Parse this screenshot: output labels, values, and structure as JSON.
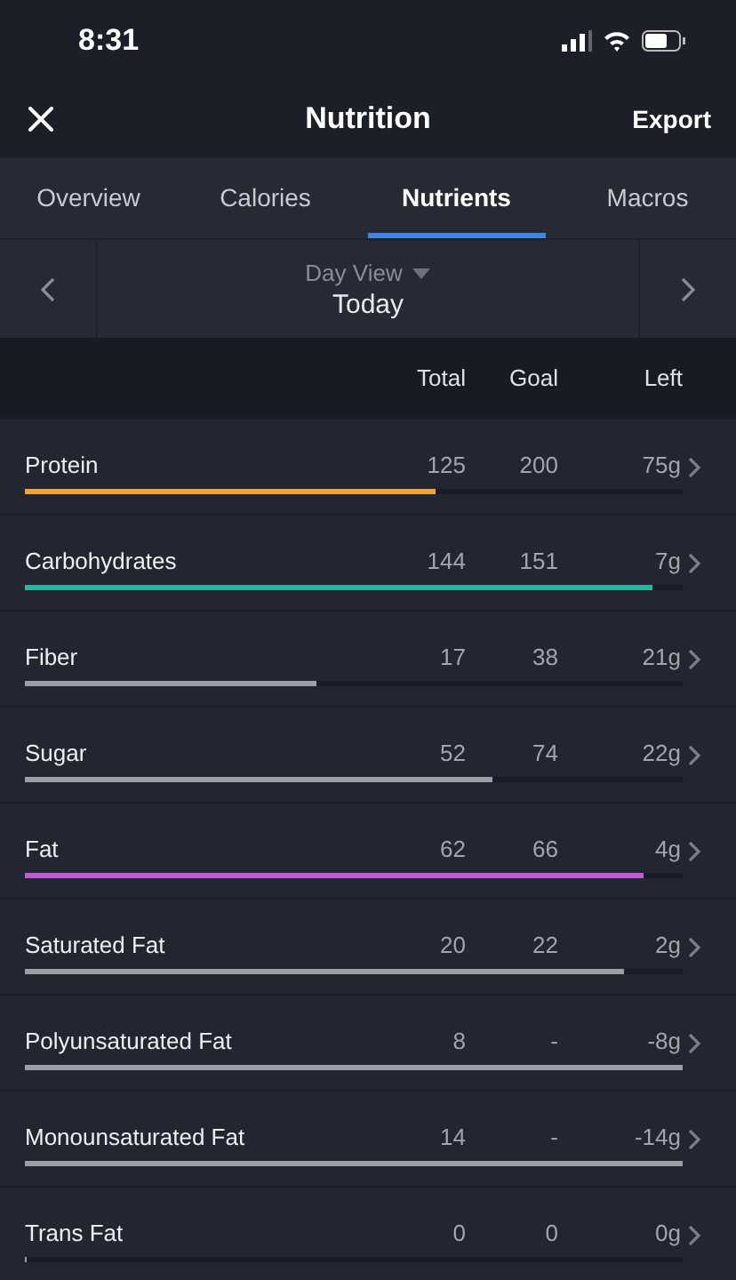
{
  "status_bar": {
    "time": "8:31"
  },
  "header": {
    "title": "Nutrition",
    "action": "Export"
  },
  "tabs": [
    {
      "label": "Overview",
      "selected": false
    },
    {
      "label": "Calories",
      "selected": false
    },
    {
      "label": "Nutrients",
      "selected": true
    },
    {
      "label": "Macros",
      "selected": false
    }
  ],
  "date_nav": {
    "view": "Day View",
    "date": "Today"
  },
  "columns": [
    "Total",
    "Goal",
    "Left"
  ],
  "nutrients": [
    {
      "name": "Protein",
      "total": "125",
      "goal": "200",
      "left": "75g",
      "level": 0.625,
      "color": "#f0a43a"
    },
    {
      "name": "Carbohydrates",
      "total": "144",
      "goal": "151",
      "left": "7g",
      "level": 0.953,
      "color": "#2bb5a0"
    },
    {
      "name": "Fiber",
      "total": "17",
      "goal": "38",
      "left": "21g",
      "level": 0.443,
      "color": "#9c9ea6"
    },
    {
      "name": "Sugar",
      "total": "52",
      "goal": "74",
      "left": "22g",
      "level": 0.71,
      "color": "#9c9ea6"
    },
    {
      "name": "Fat",
      "total": "62",
      "goal": "66",
      "left": "4g",
      "level": 0.94,
      "color": "#c05bd6"
    },
    {
      "name": "Saturated Fat",
      "total": "20",
      "goal": "22",
      "left": "2g",
      "level": 0.91,
      "color": "#9c9ea6"
    },
    {
      "name": "Polyunsaturated Fat",
      "total": "8",
      "goal": "-",
      "left": "-8g",
      "level": 1,
      "color": "#9c9ea6"
    },
    {
      "name": "Monounsaturated Fat",
      "total": "14",
      "goal": "-",
      "left": "-14g",
      "level": 1,
      "color": "#9c9ea6"
    },
    {
      "name": "Trans Fat",
      "total": "0",
      "goal": "0",
      "left": "0g",
      "level": 0,
      "color": "#9c9ea6"
    }
  ]
}
